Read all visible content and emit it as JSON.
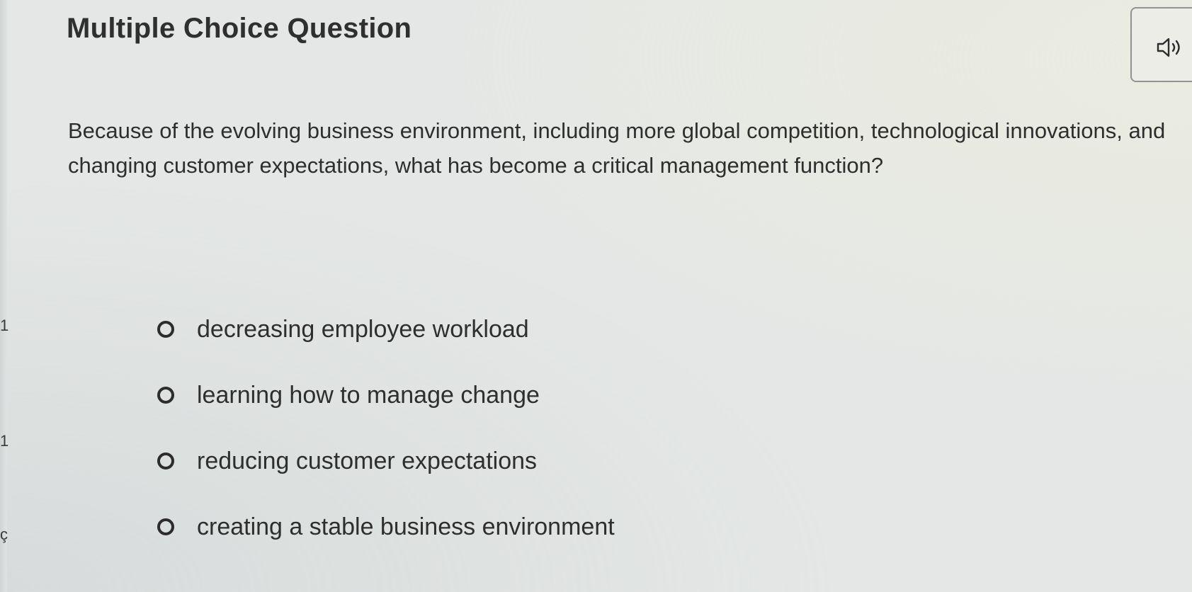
{
  "header": {
    "title": "Multiple Choice Question"
  },
  "audio": {
    "icon": "speaker-icon"
  },
  "question": {
    "text": "Because of the evolving business environment, including more global competition, technological innovations, and changing customer expectations, what has become a critical management function?"
  },
  "options": [
    {
      "label": "decreasing employee workload"
    },
    {
      "label": "learning how to manage change"
    },
    {
      "label": "reducing customer expectations"
    },
    {
      "label": "creating a stable business environment"
    }
  ],
  "left_edge_marks": [
    "1",
    "1",
    "ç"
  ],
  "colors": {
    "background": "#e4e7e5",
    "text": "#2e2e2e",
    "border": "#8f9393"
  }
}
